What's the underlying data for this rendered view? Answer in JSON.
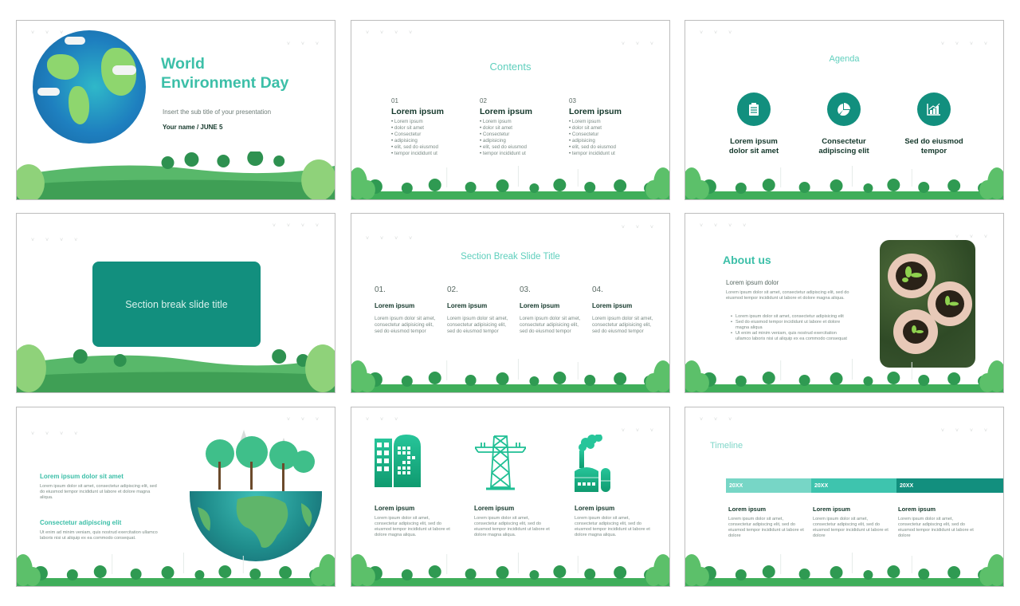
{
  "colors": {
    "accent_teal": "#3cbfa8",
    "dark_teal": "#128f7e",
    "light_teal_title": "#5fcfbd",
    "heading_dark": "#13372a",
    "body_gray": "#7a8a84",
    "timeline_1": "#77d6c6",
    "timeline_2": "#3ec4ae",
    "timeline_3": "#128f7e",
    "slide_border": "#bdbdbd"
  },
  "slides": [
    {
      "index": 1,
      "type": "title",
      "title_line1": "World",
      "title_line2": "Environment Day",
      "subtitle": "Insert the sub title of your presentation",
      "byline": "Your name  /  JUNE 5",
      "illustration": "earth-globe-with-forest"
    },
    {
      "index": 2,
      "type": "contents",
      "title": "Contents",
      "columns": [
        {
          "num": "01",
          "heading": "Lorem ipsum",
          "bullets": [
            "Lorem ipsum",
            "dolor sit amet",
            "Consectetur",
            "adipisicing",
            "elit, sed do eiusmod",
            "tempor incididunt ut"
          ]
        },
        {
          "num": "02",
          "heading": "Lorem ipsum",
          "bullets": [
            "Lorem ipsum",
            "dolor sit amet",
            "Consectetur",
            "adipisicing",
            "elit, sed do eiusmod",
            "tempor incididunt ut"
          ]
        },
        {
          "num": "03",
          "heading": "Lorem ipsum",
          "bullets": [
            "Lorem ipsum",
            "dolor sit amet",
            "Consectetur",
            "adipisicing",
            "elit, sed do eiusmod",
            "tempor incididunt ut"
          ]
        }
      ]
    },
    {
      "index": 3,
      "type": "agenda",
      "title": "Agenda",
      "items": [
        {
          "icon": "clipboard-checklist-icon",
          "line1": "Lorem ipsum",
          "line2": "dolor sit amet"
        },
        {
          "icon": "pie-chart-icon",
          "line1": "Consectetur",
          "line2": "adipiscing elit"
        },
        {
          "icon": "bar-chart-growth-icon",
          "line1": "Sed do eiusmod",
          "line2": "tempor"
        }
      ]
    },
    {
      "index": 4,
      "type": "section-break",
      "title": "Section break slide title"
    },
    {
      "index": 5,
      "type": "four-columns",
      "title": "Section Break Slide Title",
      "columns": [
        {
          "num": "01.",
          "heading": "Lorem ipsum",
          "body": "Lorem ipsum dolor sit amet, consectetur adipisicing elit, sed do eiusmod tempor"
        },
        {
          "num": "02.",
          "heading": "Lorem ipsum",
          "body": "Lorem ipsum dolor sit amet, consectetur adipisicing elit, sed do eiusmod tempor"
        },
        {
          "num": "03.",
          "heading": "Lorem ipsum",
          "body": "Lorem ipsum dolor sit amet, consectetur adipisicing elit, sed do eiusmod tempor"
        },
        {
          "num": "04.",
          "heading": "Lorem ipsum",
          "body": "Lorem ipsum dolor sit amet, consectetur adipisicing elit, sed do eiusmod tempor"
        }
      ]
    },
    {
      "index": 6,
      "type": "about",
      "title": "About us",
      "subtitle": "Lorem ipsum dolor",
      "body": "Lorem ipsum dolor sit amet, consectetur adipiscing elit, sed do eiusmod tempor incididunt ut labore et dolore magna aliqua.",
      "bullets": [
        "Lorem ipsum dolor sit amet, consectetur adipisicing elit",
        "Sed do eiusmod tempor incididunt ut labore et dolore magna aliqua",
        "Ut enim ad minim veniam, quis nostrud exercitation ullamco laboris nisi ut aliquip ex ea commodo consequat"
      ],
      "photo": "hands-holding-seedlings-photo"
    },
    {
      "index": 7,
      "type": "text-with-earth",
      "blocks": [
        {
          "heading": "Lorem ipsum dolor sit amet",
          "body": "Lorem ipsum dolor sit amet, consectetur adipiscing elit, sed do eiusmod tempor incididunt ut labore et dolore magna aliqua."
        },
        {
          "heading": "Consectetur adipiscing elit",
          "body": "Ut enim ad minim veniam, quis nostrud exercitation ullamco laboris nisi ut aliquip ex ea commodo consequat."
        }
      ],
      "illustration": "half-earth-with-city"
    },
    {
      "index": 8,
      "type": "three-icons",
      "columns": [
        {
          "icon": "buildings-icon",
          "heading": "Lorem ipsum",
          "body": "Lorem ipsum dolor sit amet, consectetur adipiscing elit, sed do eiusmod tempor incididunt ut labore et dolore magna aliqua."
        },
        {
          "icon": "power-tower-icon",
          "heading": "Lorem ipsum",
          "body": "Lorem ipsum dolor sit amet, consectetur adipiscing elit, sed do eiusmod tempor incididunt ut labore et dolore magna aliqua."
        },
        {
          "icon": "factory-icon",
          "heading": "Lorem ipsum",
          "body": "Lorem ipsum dolor sit amet, consectetur adipiscing elit, sed do eiusmod tempor incididunt ut labore et dolore magna aliqua."
        }
      ]
    },
    {
      "index": 9,
      "type": "timeline",
      "title": "Timeline",
      "steps": [
        {
          "year": "20XX",
          "heading": "Lorem ipsum",
          "body": "Lorem ipsum dolor sit amet, consectetur adipiscing elit, sed do eiusmod tempor incididunt ut labore et dolore"
        },
        {
          "year": "20XX",
          "heading": "Lorem ipsum",
          "body": "Lorem ipsum dolor sit amet, consectetur adipiscing elit, sed do eiusmod tempor incididunt ut labore et dolore"
        },
        {
          "year": "20XX",
          "heading": "Lorem ipsum",
          "body": "Lorem ipsum dolor sit amet, consectetur adipiscing elit, sed do eiusmod tempor incididunt ut labore et dolore"
        }
      ]
    }
  ]
}
